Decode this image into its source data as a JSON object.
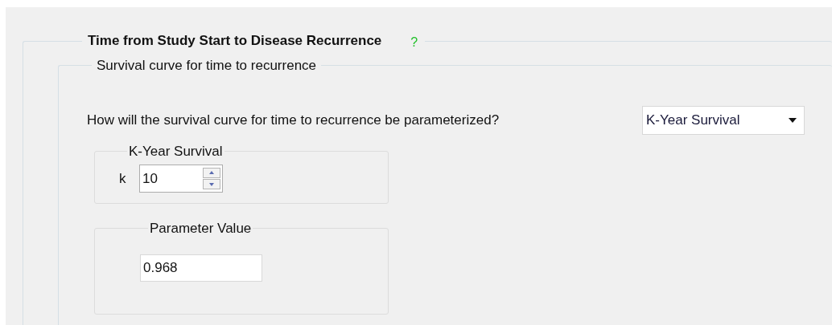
{
  "section": {
    "title": "Time from Study Start to Disease Recurrence",
    "help": "?"
  },
  "group": {
    "title": "Survival curve for time to recurrence",
    "question": "How will the survival curve for time to recurrence be parameterized?",
    "parameterization": {
      "value": "K-Year Survival"
    },
    "k_group": {
      "title": "K-Year Survival",
      "label": "k",
      "value": "10"
    },
    "parameter_group": {
      "title": "Parameter Value",
      "value": "0.968"
    }
  }
}
